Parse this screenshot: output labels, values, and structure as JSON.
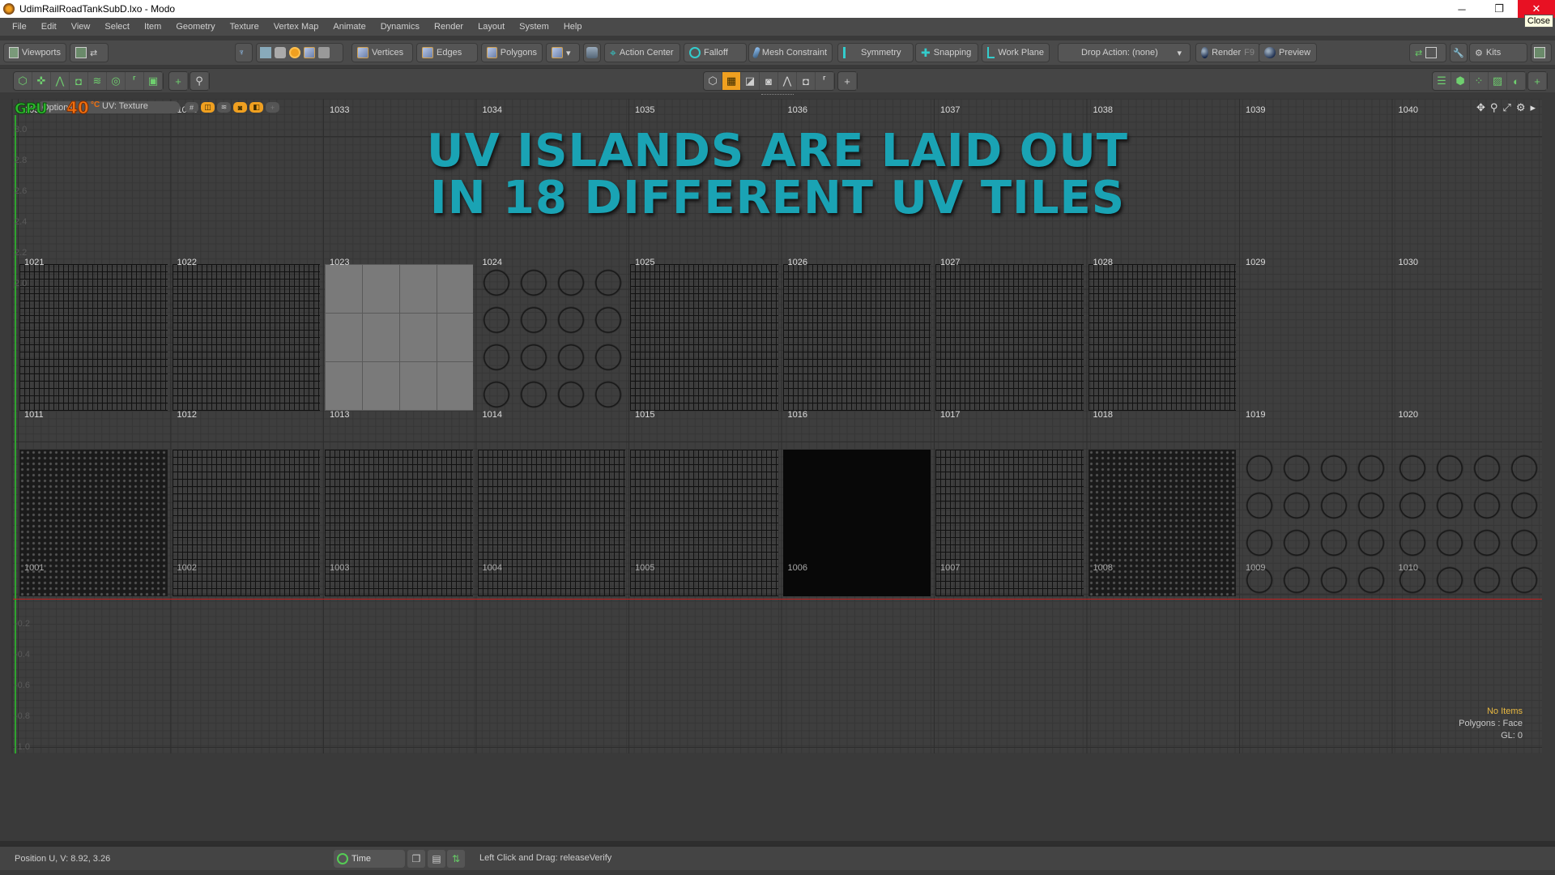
{
  "window": {
    "title": "UdimRailRoadTankSubD.lxo - Modo",
    "minimize_glyph": "─",
    "restore_glyph": "❐",
    "close_glyph": "✕",
    "close_tooltip": "Close"
  },
  "menu": [
    "File",
    "Edit",
    "View",
    "Select",
    "Item",
    "Geometry",
    "Texture",
    "Vertex Map",
    "Animate",
    "Dynamics",
    "Render",
    "Layout",
    "System",
    "Help"
  ],
  "toolbar": {
    "viewports": "Viewports",
    "vertices": "Vertices",
    "edges": "Edges",
    "polygons": "Polygons",
    "action_center": "Action Center",
    "falloff": "Falloff",
    "mesh_constraint": "Mesh Constraint",
    "symmetry": "Symmetry",
    "snapping": "Snapping",
    "work_plane": "Work Plane",
    "drop_action": "Drop Action: (none)",
    "render": "Render",
    "render_shortcut": "F9",
    "preview": "Preview",
    "kits": "Kits"
  },
  "viewport": {
    "gpu_label": "GPU",
    "options_label": "Options...",
    "temperature": "40",
    "temperature_unit": "°C",
    "view_label": "UV: Texture",
    "overlay_line1": "UV ISLANDS ARE LAID OUT",
    "overlay_line2": "IN 18 DIFFERENT UV TILES",
    "v_axis_labels": [
      "3.0",
      "2.8",
      "2.6",
      "2.4",
      "2.2",
      "2.0",
      "-0.2",
      "-0.4",
      "-0.6",
      "-0.8",
      "-1.0"
    ],
    "tiles_row_top": [
      "1031",
      "1032",
      "1033",
      "1034",
      "1035",
      "1036",
      "1037",
      "1038",
      "1039",
      "1040"
    ],
    "tiles_row_mid": [
      "1021",
      "1022",
      "1023",
      "1024",
      "1025",
      "1026",
      "1027",
      "1028",
      "1029",
      "1030"
    ],
    "tiles_row_low": [
      "1011",
      "1012",
      "1013",
      "1014",
      "1015",
      "1016",
      "1017",
      "1018",
      "1019",
      "1020"
    ],
    "tiles_row_bottom": [
      "1001",
      "1002",
      "1003",
      "1004",
      "1005",
      "1006",
      "1007",
      "1008",
      "1009",
      "1010"
    ],
    "info_items": "No Items",
    "info_mode": "Polygons : Face",
    "info_gl": "GL: 0"
  },
  "status": {
    "position": "Position U, V:   8.92, 3.26",
    "time_label": "Time",
    "hint": "Left Click and Drag:   releaseVerify"
  },
  "colors": {
    "accent_orange": "#f0a020",
    "overlay_teal": "#1aa3b4",
    "axis_green": "#2fa32f",
    "axis_red": "#c02020",
    "info_yellow": "#e8b840"
  }
}
